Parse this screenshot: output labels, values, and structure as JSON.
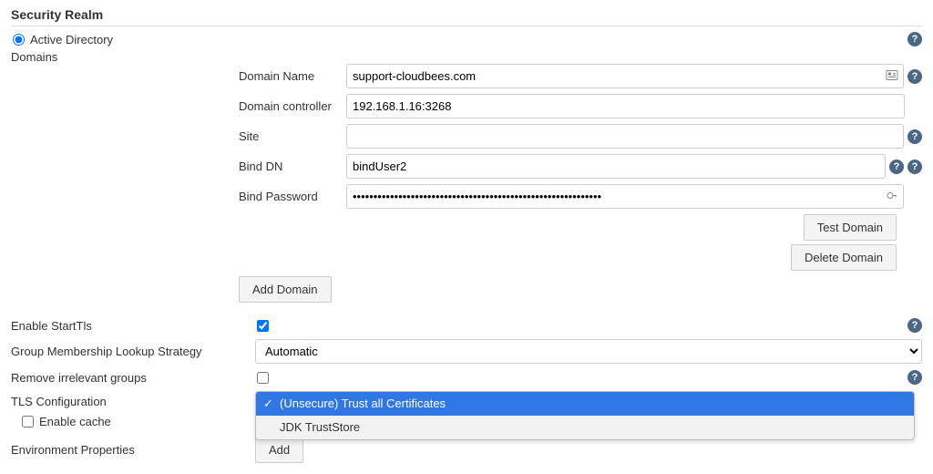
{
  "section_title": "Security Realm",
  "radio": {
    "active_directory": "Active Directory"
  },
  "domains_label": "Domains",
  "domain": {
    "name_label": "Domain Name",
    "name_value": "support-cloudbees.com",
    "controller_label": "Domain controller",
    "controller_value": "192.168.1.16:3268",
    "site_label": "Site",
    "site_value": "",
    "binddn_label": "Bind DN",
    "binddn_value": "bindUser2",
    "bindpw_label": "Bind Password",
    "bindpw_value": "••••••••••••••••••••••••••••••••••••••••••••••••••••••••••••",
    "test_btn": "Test Domain",
    "delete_btn": "Delete Domain",
    "add_btn": "Add Domain"
  },
  "starttls": {
    "label": "Enable StartTls",
    "checked": true
  },
  "group_strategy": {
    "label": "Group Membership Lookup Strategy",
    "value": "Automatic"
  },
  "remove_groups": {
    "label": "Remove irrelevant groups",
    "checked": false
  },
  "tls_config": {
    "label": "TLS Configuration",
    "options": [
      "(Unsecure) Trust all Certificates",
      "JDK TrustStore"
    ],
    "selected_index": 0
  },
  "enable_cache": {
    "label": "Enable cache",
    "checked": false
  },
  "env_props": {
    "label": "Environment Properties",
    "add_btn": "Add"
  }
}
